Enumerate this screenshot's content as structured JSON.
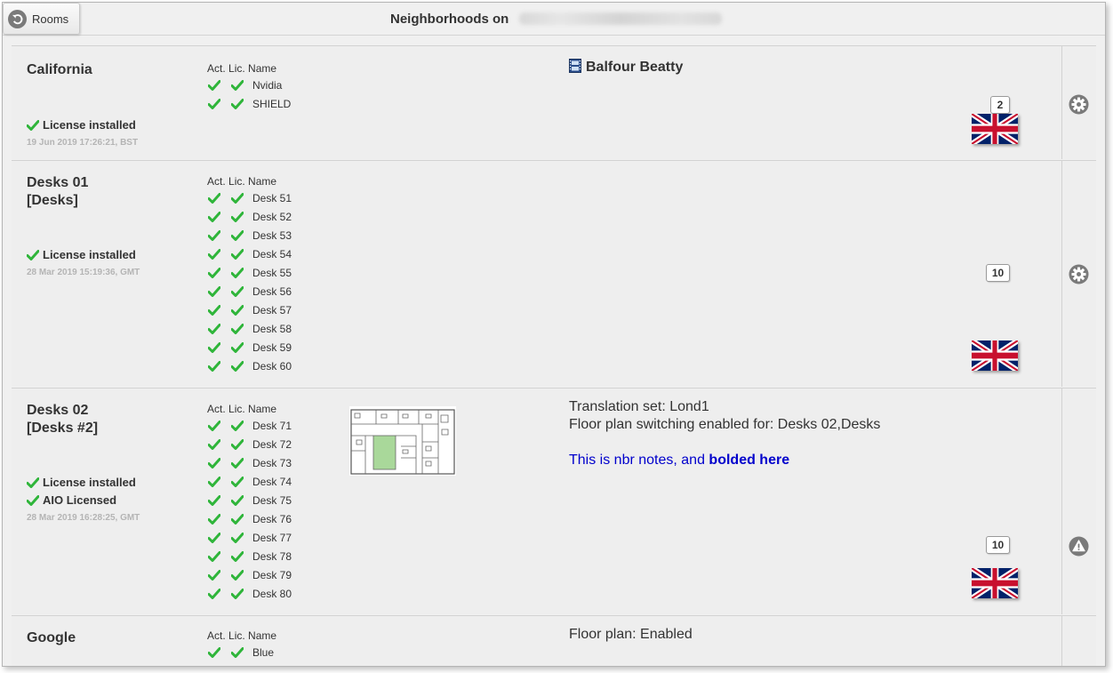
{
  "header": {
    "back_label": "Rooms",
    "title": "Neighborhoods on"
  },
  "columns": {
    "act": "Act.",
    "lic": "Lic.",
    "name": "Name"
  },
  "neighborhoods": [
    {
      "name_line1": "California",
      "status": [
        "License installed"
      ],
      "date": "19 Jun 2019 17:26:21, BST",
      "devices": [
        "Nvidia",
        "SHIELD"
      ],
      "info_title": "Balfour Beatty",
      "count": "2",
      "action_icon": "gear-icon"
    },
    {
      "name_line1": "Desks 01",
      "name_line2": "[Desks]",
      "status": [
        "License installed"
      ],
      "date": "28 Mar 2019 15:19:36, GMT",
      "devices": [
        "Desk 51",
        "Desk 52",
        "Desk 53",
        "Desk 54",
        "Desk 55",
        "Desk 56",
        "Desk 57",
        "Desk 58",
        "Desk 59",
        "Desk 60"
      ],
      "count": "10",
      "action_icon": "gear-icon"
    },
    {
      "name_line1": "Desks 02",
      "name_line2": "[Desks #2]",
      "status": [
        "License installed",
        "AIO Licensed"
      ],
      "date": "28 Mar 2019 16:28:25, GMT",
      "devices": [
        "Desk 71",
        "Desk 72",
        "Desk 73",
        "Desk 74",
        "Desk 75",
        "Desk 76",
        "Desk 77",
        "Desk 78",
        "Desk 79",
        "Desk 80"
      ],
      "info_lines": [
        "Translation set: Lond1",
        "Floor plan switching enabled for: Desks 02,Desks"
      ],
      "notes_text": "This is nbr notes, and ",
      "notes_bold": "bolded here",
      "count": "10",
      "action_icon": "warning-icon"
    },
    {
      "name_line1": "Google",
      "devices": [
        "Blue"
      ],
      "info_lines": [
        "Floor plan: Enabled"
      ]
    }
  ],
  "colors": {
    "check": "#2fb53a",
    "row_bg": "#eeeeee",
    "notes": "#0000cc",
    "icon_gray": "#7a7a7a"
  }
}
